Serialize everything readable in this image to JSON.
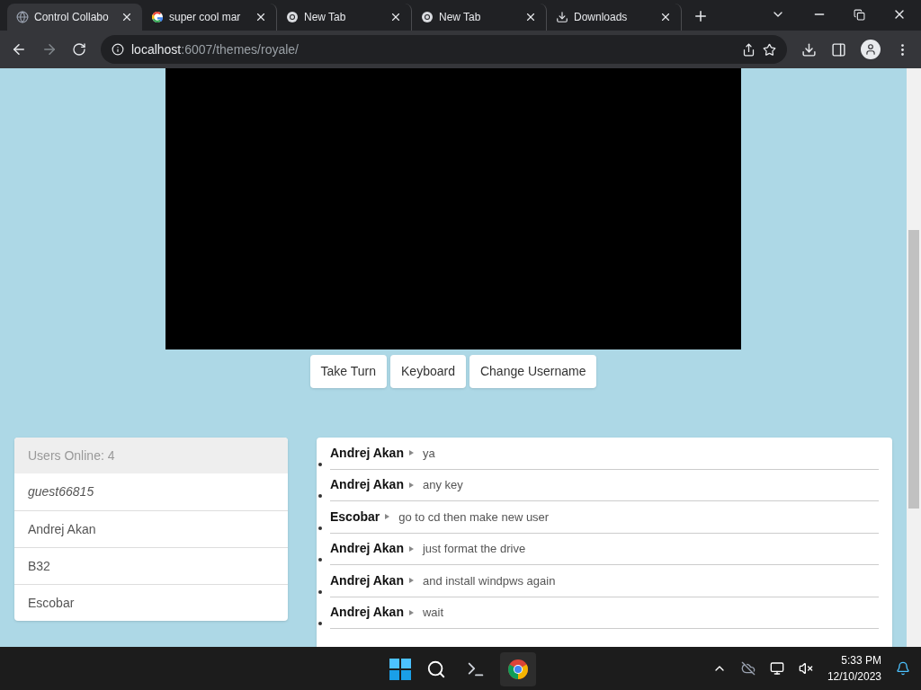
{
  "browser": {
    "tabs": [
      {
        "title": "Control Collabo",
        "kind": "globe",
        "selected": true
      },
      {
        "title": "super cool mar",
        "kind": "google",
        "selected": false
      },
      {
        "title": "New Tab",
        "kind": "chrome",
        "selected": false
      },
      {
        "title": "New Tab",
        "kind": "chrome",
        "selected": false
      },
      {
        "title": "Downloads",
        "kind": "download",
        "selected": false
      }
    ],
    "url_host": "localhost",
    "url_path": ":6007/themes/royale/"
  },
  "controls": [
    "Take Turn",
    "Keyboard",
    "Change Username"
  ],
  "users": {
    "header": "Users Online: 4",
    "items": [
      {
        "name": "guest66815",
        "self": true
      },
      {
        "name": "Andrej Akan",
        "self": false
      },
      {
        "name": "B32",
        "self": false
      },
      {
        "name": "Escobar",
        "self": false
      }
    ]
  },
  "chat": [
    {
      "user": "Andrej Akan",
      "text": "ya"
    },
    {
      "user": "Andrej Akan",
      "text": "any key"
    },
    {
      "user": "Escobar",
      "text": "go to cd then make new user"
    },
    {
      "user": "Andrej Akan",
      "text": "just format the drive"
    },
    {
      "user": "Andrej Akan",
      "text": "and install windpws again"
    },
    {
      "user": "Andrej Akan",
      "text": "wait"
    }
  ],
  "taskbar": {
    "time": "5:33 PM",
    "date": "12/10/2023"
  }
}
